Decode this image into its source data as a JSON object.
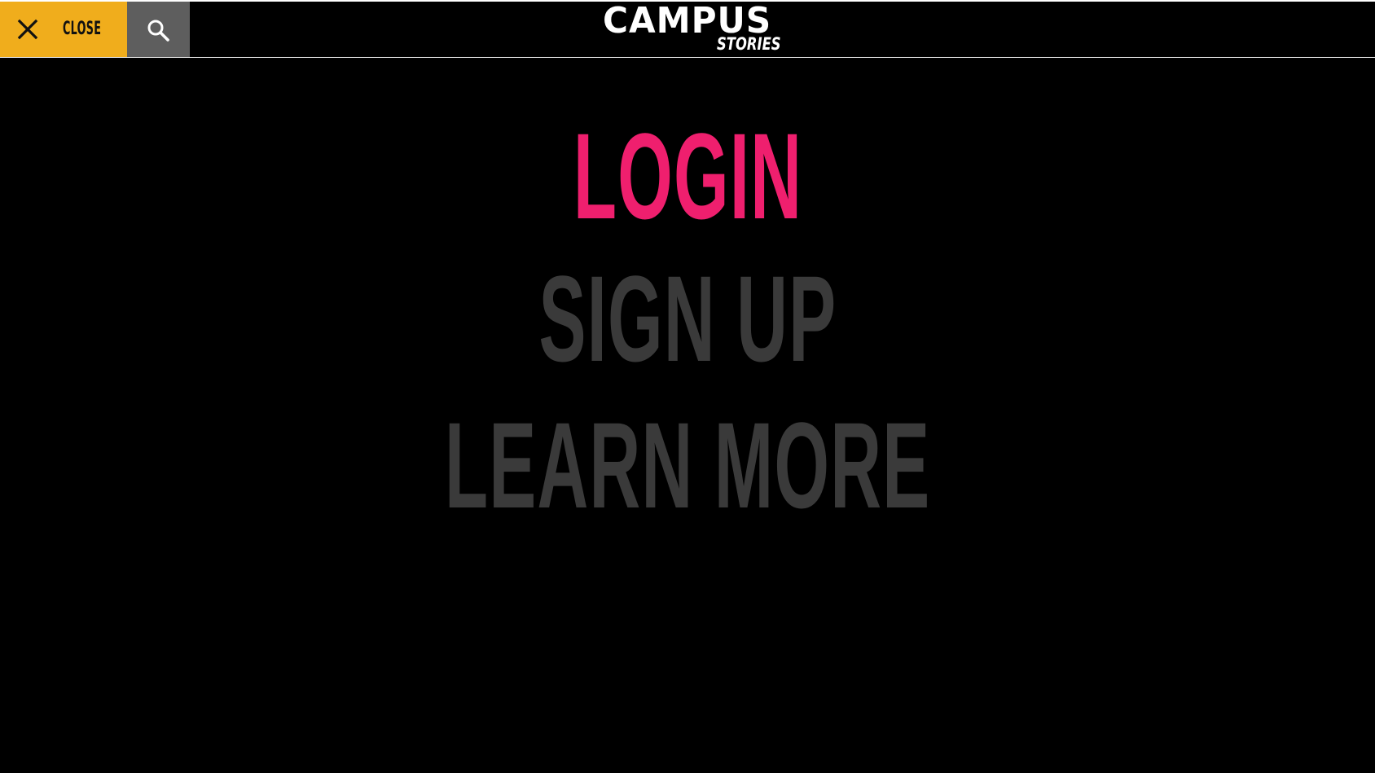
{
  "header": {
    "close_label": "CLOSE",
    "close_icon": "close-icon",
    "search_icon": "search-icon",
    "logo": {
      "main": "CAMPUS",
      "sub": "STORIES"
    }
  },
  "menu": {
    "items": [
      {
        "label": "LOGIN",
        "active": true
      },
      {
        "label": "SIGN UP",
        "active": false
      },
      {
        "label": "LEARN MORE",
        "active": false
      }
    ]
  },
  "colors": {
    "background": "#000000",
    "close_button": "#f0ad1c",
    "search_button": "#5e5e5e",
    "active_item": "#ef1f6e",
    "inactive_item": "#3a3a3a",
    "logo": "#ffffff"
  }
}
